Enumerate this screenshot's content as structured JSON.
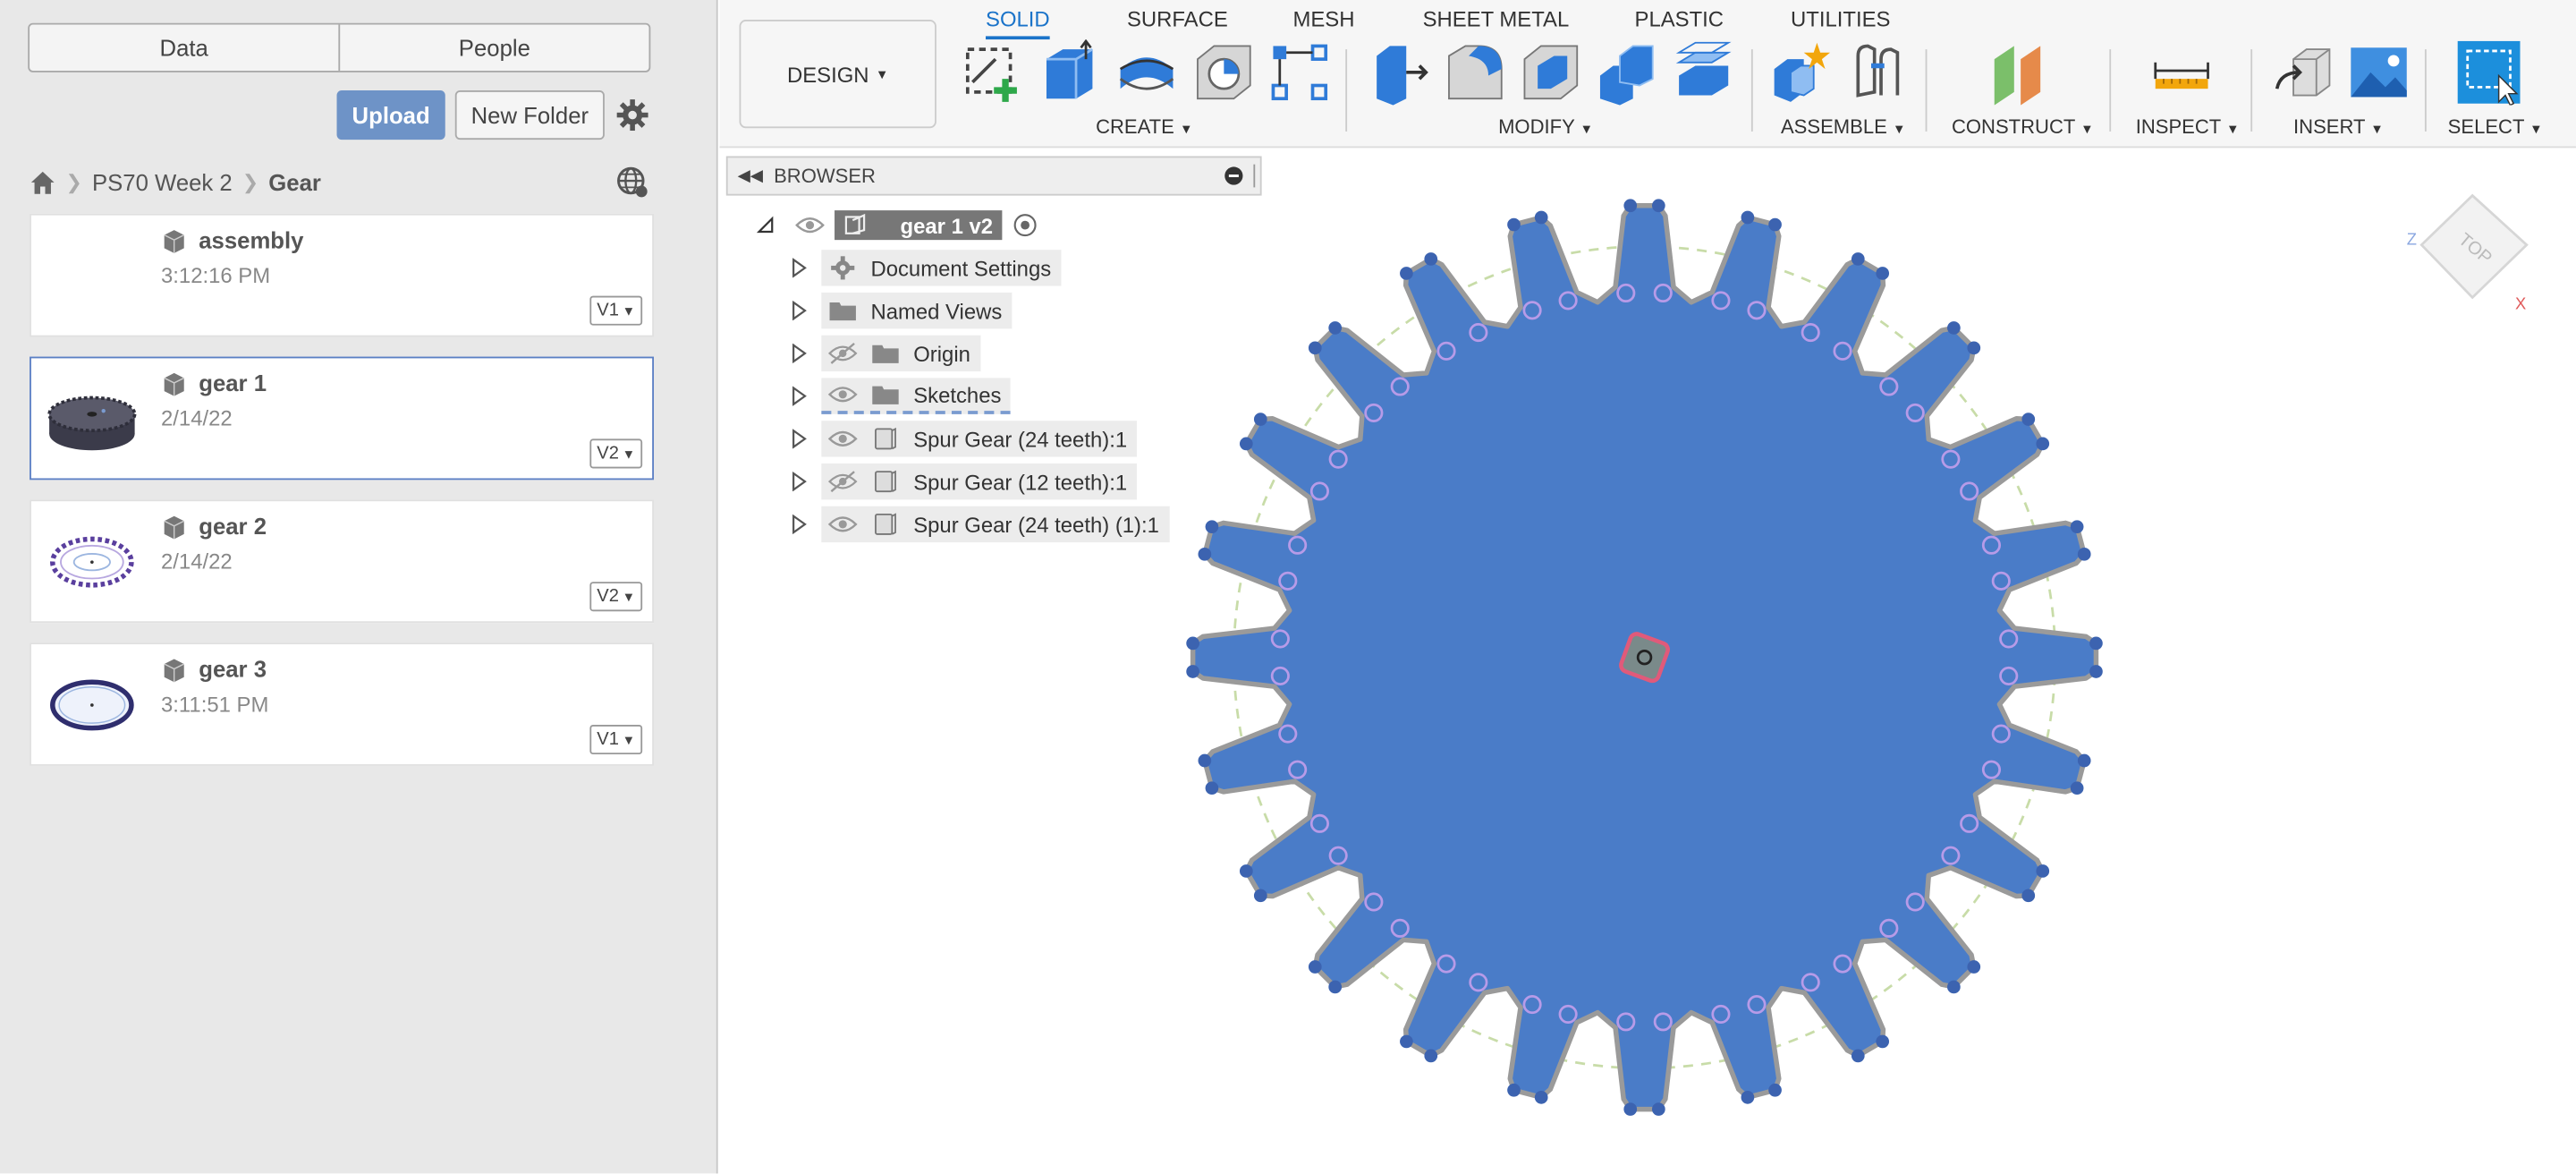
{
  "data_panel": {
    "tabs": [
      "Data",
      "People"
    ],
    "upload_label": "Upload",
    "new_folder_label": "New Folder",
    "breadcrumb": {
      "project": "PS70 Week 2",
      "folder": "Gear"
    },
    "files": [
      {
        "name": "assembly",
        "time": "3:12:16 PM",
        "version": "V1"
      },
      {
        "name": "gear 1",
        "time": "2/14/22",
        "version": "V2"
      },
      {
        "name": "gear 2",
        "time": "2/14/22",
        "version": "V2"
      },
      {
        "name": "gear 3",
        "time": "3:11:51 PM",
        "version": "V1"
      }
    ]
  },
  "toolbar": {
    "workspace": "DESIGN",
    "tabs": [
      "SOLID",
      "SURFACE",
      "MESH",
      "SHEET METAL",
      "PLASTIC",
      "UTILITIES"
    ],
    "active_tab": "SOLID",
    "groups": [
      "CREATE",
      "MODIFY",
      "ASSEMBLE",
      "CONSTRUCT",
      "INSPECT",
      "INSERT",
      "SELECT"
    ]
  },
  "browser": {
    "title": "BROWSER",
    "root": "gear 1 v2",
    "items": [
      "Document Settings",
      "Named Views",
      "Origin",
      "Sketches",
      "Spur Gear (24 teeth):1",
      "Spur Gear (12 teeth):1",
      "Spur Gear (24 teeth) (1):1"
    ]
  },
  "viewcube": {
    "face": "TOP"
  },
  "colors": {
    "gear_fill": "#4a7cc8",
    "accent": "#1a73c9",
    "upload": "#6e93c7"
  }
}
